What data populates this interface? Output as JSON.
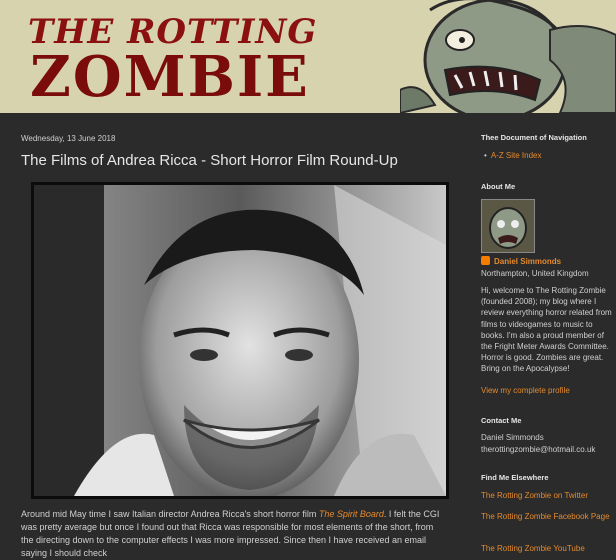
{
  "header": {
    "title_line1": "THE ROTTING",
    "title_line2": "ZOMBIE"
  },
  "post": {
    "date": "Wednesday, 13 June 2018",
    "title": "The Films of Andrea Ricca - Short Horror Film Round-Up",
    "photo_icon": "portrait-photo",
    "body_prefix": "Around mid May time I saw Italian director Andrea Ricca's short horror film ",
    "body_link": "The Spirit Board",
    "body_suffix": ". I felt the CGI was pretty average but once I found out that Ricca was responsible for most elements of the short, from the directing down to the computer effects I was more impressed. Since then I have received an email saying I should check"
  },
  "sidebar": {
    "nav_title": "Thee Document of Navigation",
    "nav_items": [
      "A-Z Site Index"
    ],
    "about_title": "About Me",
    "profile_name": "Daniel Simmonds",
    "profile_location": "Northampton, United Kingdom",
    "profile_about": "Hi, welcome to The Rotting Zombie (founded 2008); my blog where I review everything horror related from films to videogames to music to books. I'm also a proud member of the Fright Meter Awards Committee. Horror is good. Zombies are great. Bring on the Apocalypse!",
    "profile_link": "View my complete profile",
    "contact_title": "Contact Me",
    "contact_name": "Daniel Simmonds",
    "contact_email": "therottingzombie@hotmail.co.uk",
    "find_title": "Find Me Elsewhere",
    "find_links": [
      "The Rotting Zombie on Twitter",
      "The Rotting Zombie Facebook Page",
      "The Rotting Zombie YouTube"
    ]
  },
  "colors": {
    "background": "#2b2b2b",
    "link": "#e58a2e",
    "header_bg": "#d7d3ae",
    "title_red": "#7a0c0c"
  }
}
